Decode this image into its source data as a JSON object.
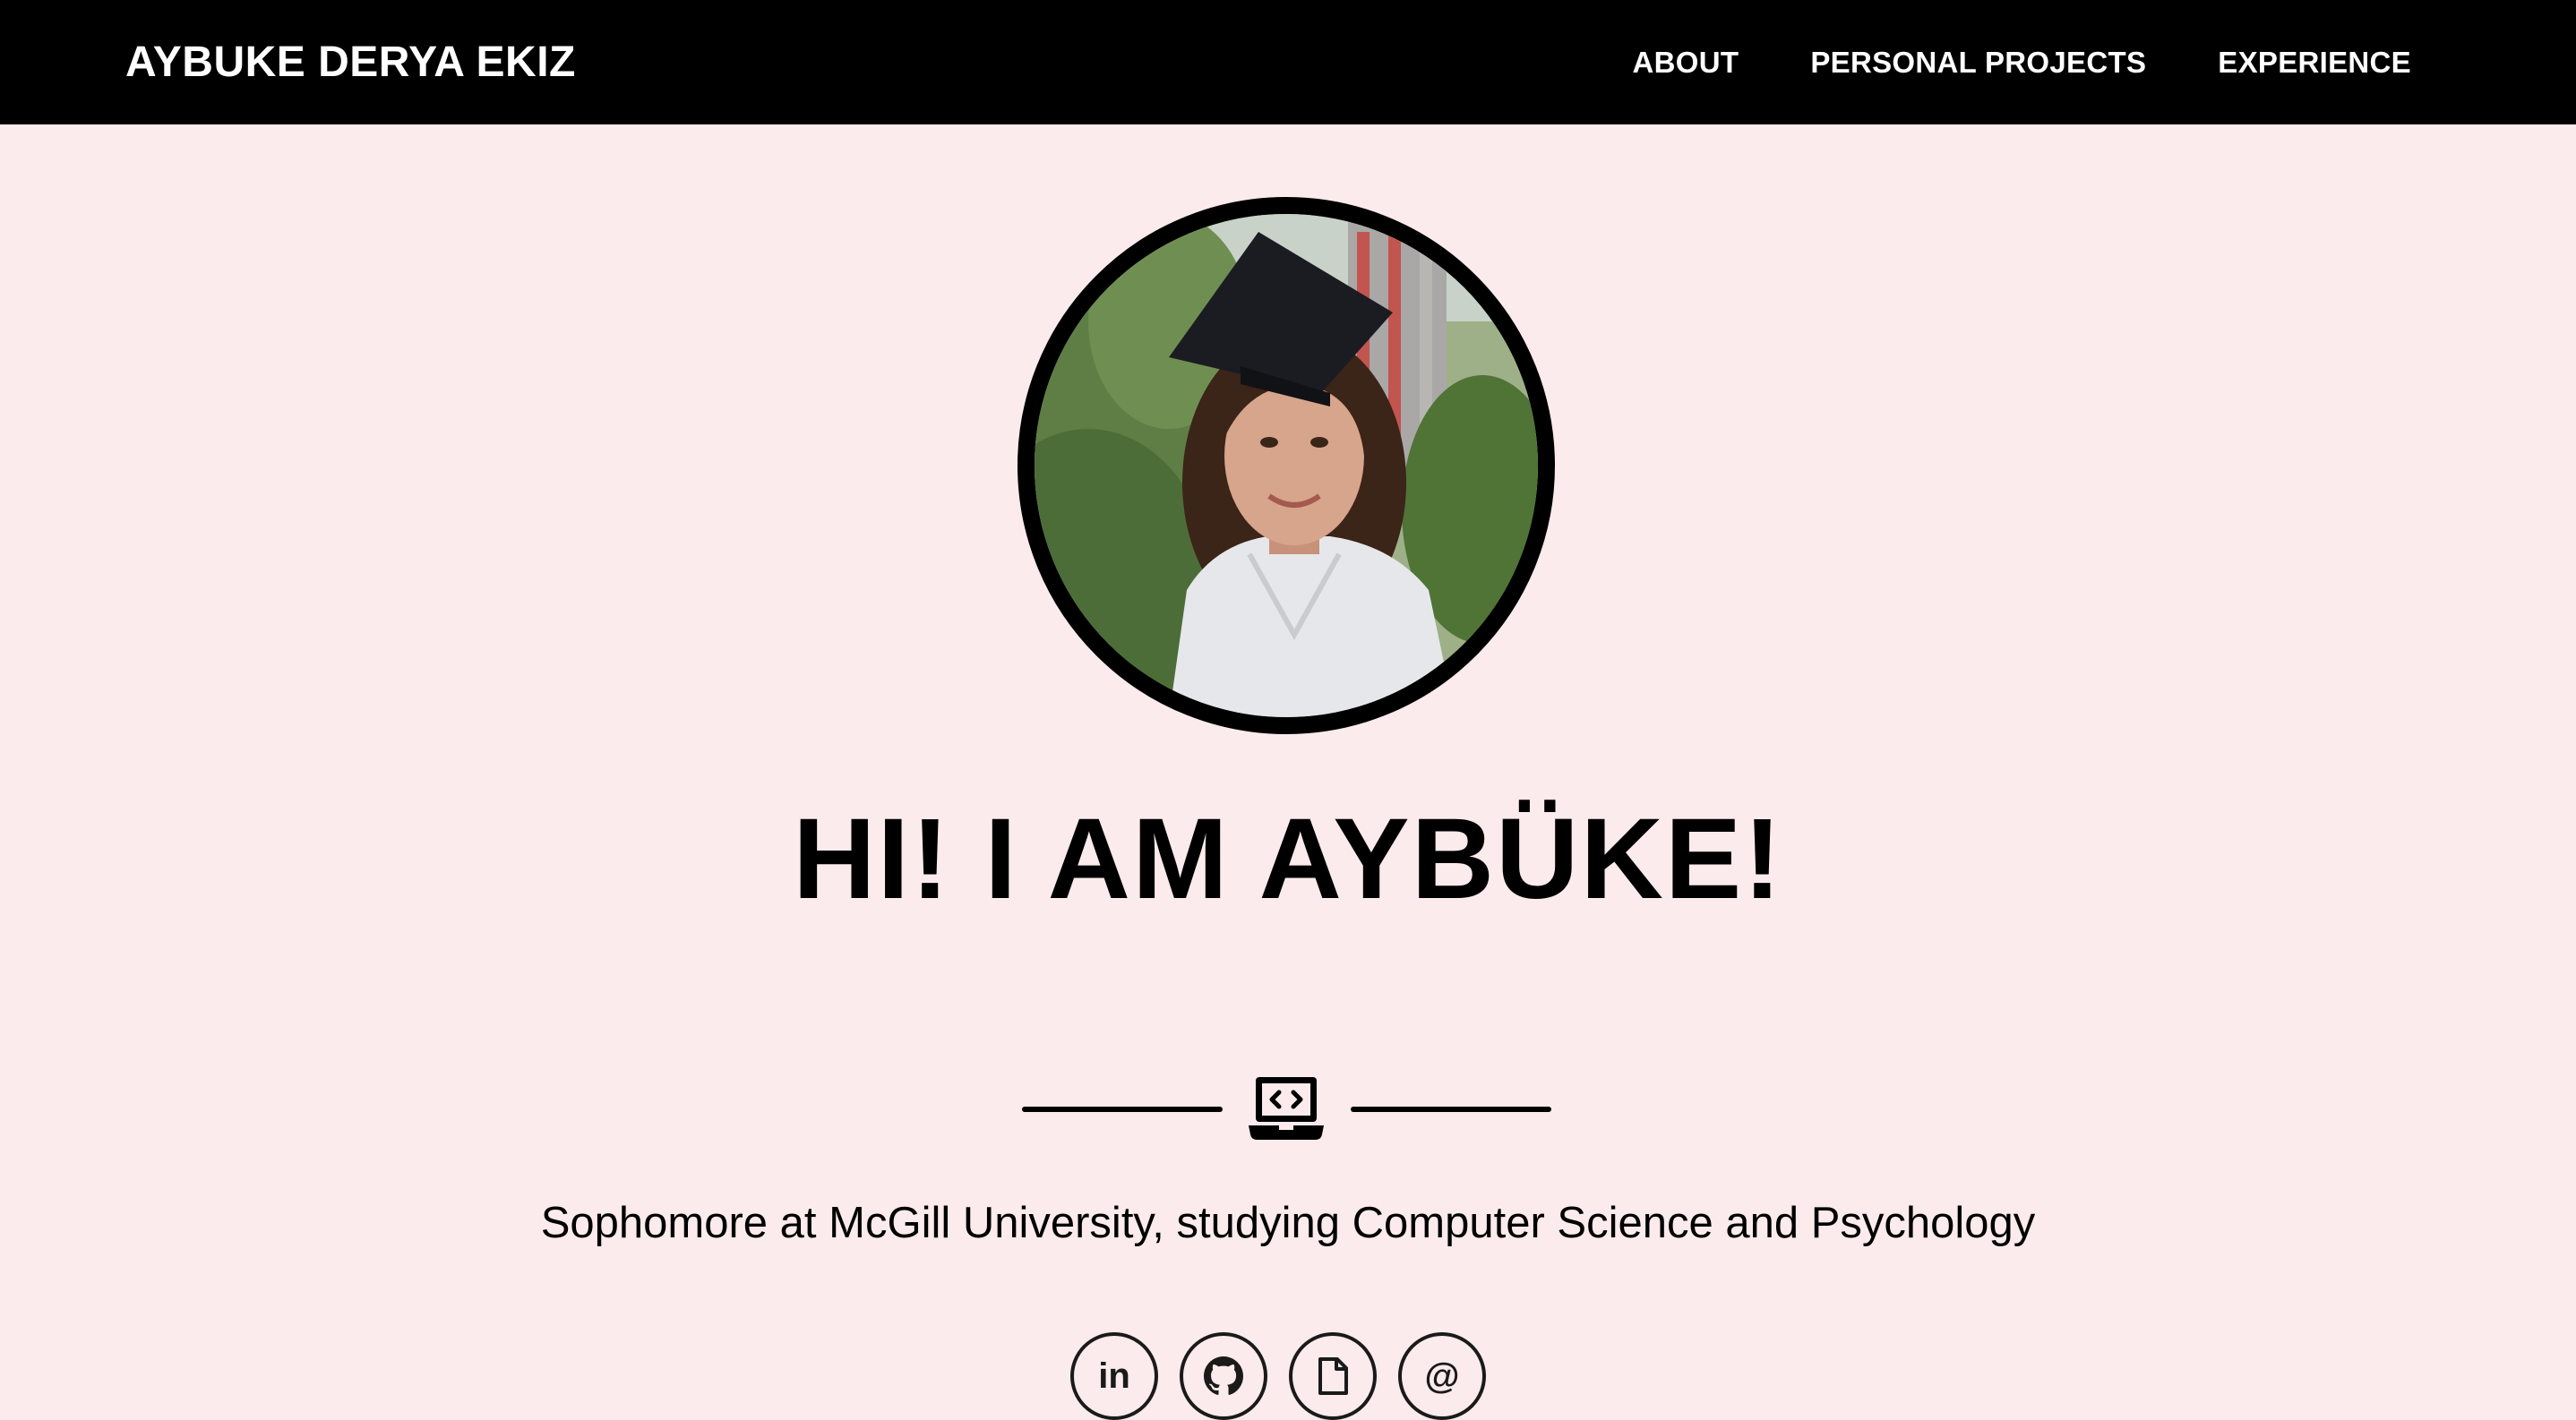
{
  "nav": {
    "brand": "AYBUKE DERYA EKIZ",
    "links": [
      "ABOUT",
      "PERSONAL PROJECTS",
      "EXPERIENCE"
    ]
  },
  "hero": {
    "headline": "HI! I AM AYBÜKE!",
    "subtitle": "Sophomore at McGill University, studying Computer Science and Psychology",
    "divider_icon": "laptop-code-icon",
    "socials": [
      {
        "name": "linkedin",
        "icon": "linkedin-icon",
        "glyph": "in"
      },
      {
        "name": "github",
        "icon": "github-icon"
      },
      {
        "name": "resume",
        "icon": "file-icon"
      },
      {
        "name": "email",
        "icon": "at-icon",
        "glyph": "@"
      }
    ]
  },
  "colors": {
    "nav_bg": "#000000",
    "page_bg": "#fbebec",
    "text": "#000000",
    "nav_text": "#ffffff"
  }
}
